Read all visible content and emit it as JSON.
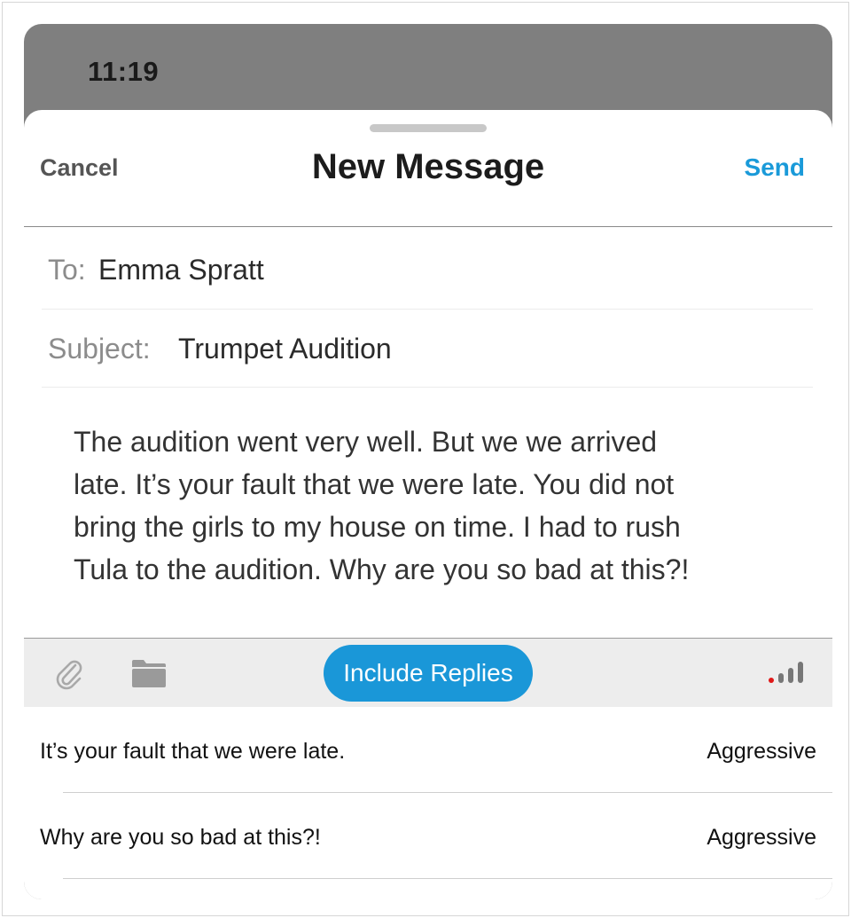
{
  "status_bar": {
    "time": "11:19"
  },
  "nav": {
    "cancel_label": "Cancel",
    "title": "New Message",
    "send_label": "Send"
  },
  "fields": {
    "to_label": "To:",
    "to_value": "Emma Spratt",
    "subject_label": "Subject:",
    "subject_value": "Trumpet Audition"
  },
  "message": {
    "lines": [
      "The audition went very well. But we we arrived",
      "late. It’s your fault that we were late. You did not",
      "bring the girls to my house on time. I had to rush",
      "Tula to the audition. Why are you so bad at this?!"
    ]
  },
  "toolbar": {
    "attachment_icon": "paperclip-icon",
    "folder_icon": "folder-icon",
    "include_replies_label": "Include Replies",
    "signal_icon": "signal-strength-icon",
    "accent_color": "#1a97d8"
  },
  "replies": [
    {
      "text": "It’s your fault that we were late.",
      "tone": "Aggressive"
    },
    {
      "text": "Why are you so bad at this?!",
      "tone": "Aggressive"
    }
  ]
}
